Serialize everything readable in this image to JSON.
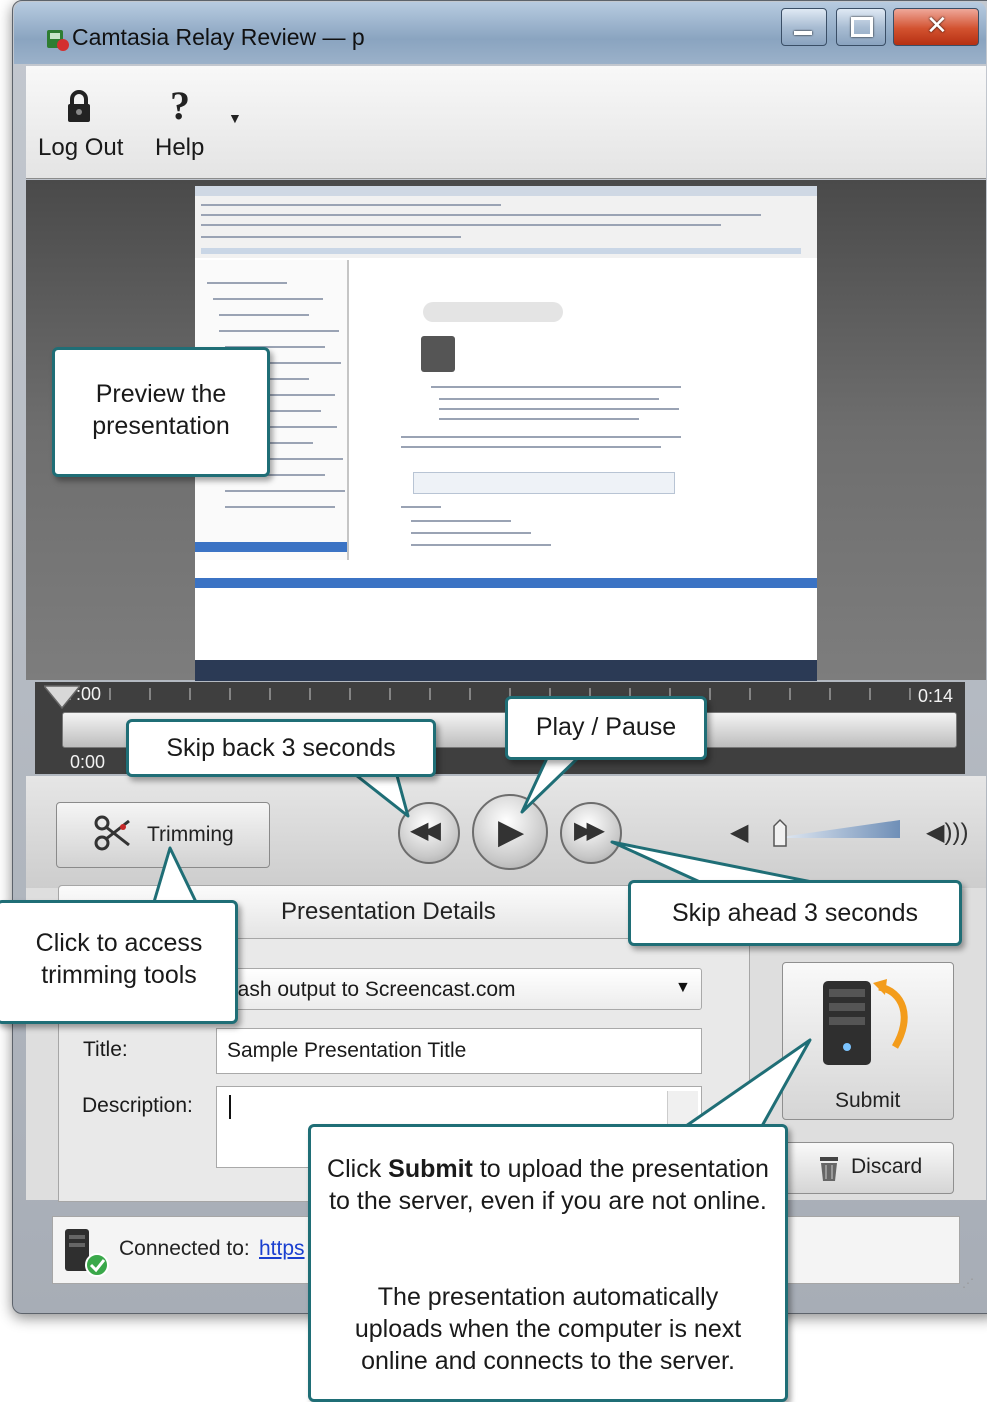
{
  "window": {
    "title": "Camtasia Relay Review — p"
  },
  "toolbar": {
    "logout_label": "Log Out",
    "help_label": "Help"
  },
  "timeline": {
    "start_time": ":00",
    "end_time": "0:14",
    "current_time": "0:00"
  },
  "controls": {
    "trimming_label": "Trimming"
  },
  "details": {
    "tab_label": "Presentation Details",
    "output_value": "lash output to Screencast.com",
    "title_label": "Title:",
    "title_value": "Sample Presentation Title",
    "description_label": "Description:",
    "description_value": "",
    "submit_label": "Submit",
    "discard_label": "Discard"
  },
  "status": {
    "connected_label": "Connected to:",
    "connected_link": "https"
  },
  "callouts": {
    "preview": "Preview the presentation",
    "skip_back": "Skip back 3 seconds",
    "play_pause": "Play / Pause",
    "skip_ahead": "Skip ahead 3 seconds",
    "trimming": "Click to access trimming tools",
    "submit_pre": "Click ",
    "submit_bold": "Submit",
    "submit_post": " to upload the presentation to the server, even if you are not online.",
    "submit_para2": "The presentation automatically uploads when the computer is next online and connects to the server."
  },
  "colors": {
    "callout_border": "#1f6e76",
    "link": "#1a3fd0",
    "close_button": "#c94326"
  },
  "volume": {
    "level": 0.05
  }
}
